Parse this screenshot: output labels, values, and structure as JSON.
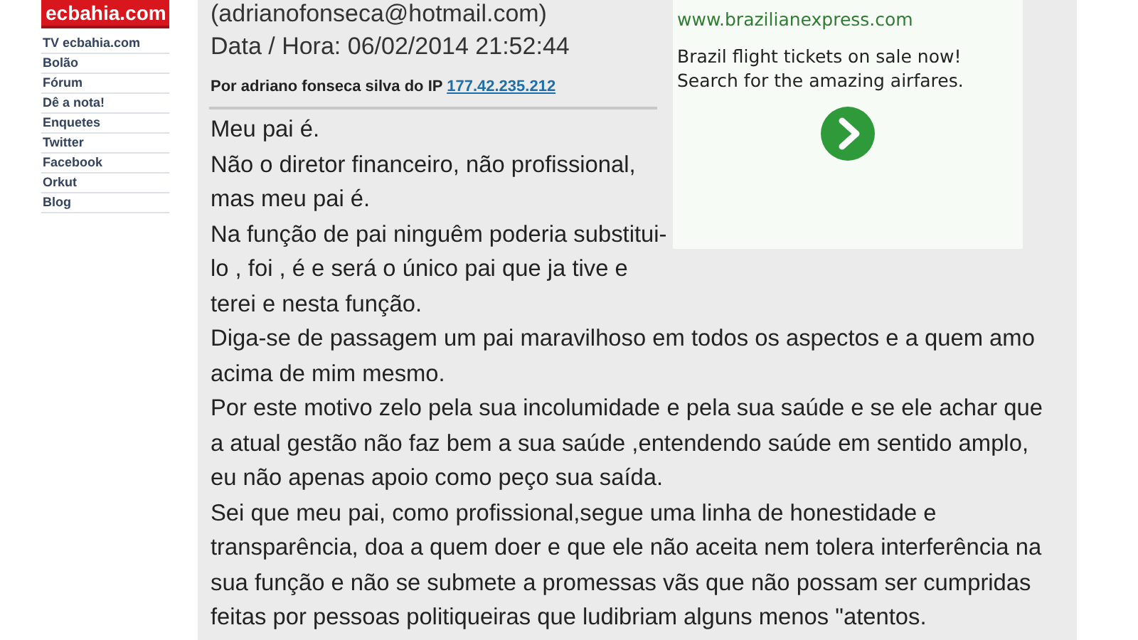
{
  "sidebar": {
    "logo": "ecbahia.com",
    "links": [
      "TV ecbahia.com",
      "Bolão",
      "Fórum",
      "Dê a nota!",
      "Enquetes",
      "Twitter",
      "Facebook",
      "Orkut",
      "Blog"
    ]
  },
  "post": {
    "email": "(adrianofonseca@hotmail.com)",
    "datetime": "Data / Hora: 06/02/2014 21:52:44",
    "author": "Por adriano fonseca silva do IP",
    "ip": "177.42.235.212",
    "paragraphs": [
      "Meu pai é.",
      "Não o diretor financeiro, não profissional, mas meu pai é.",
      "Na função de pai ninguêm poderia substitui-lo , foi , é e será o único pai que ja tive e terei e nesta função.",
      "Diga-se de passagem um pai maravilhoso em todos os aspectos e a quem amo acima de mim mesmo.",
      "Por este motivo zelo pela sua incolumidade e pela sua saúde e se ele achar que a atual gestão não faz bem a sua saúde ,entendendo saúde em sentido amplo, eu não apenas apoio como peço sua saída.",
      "Sei que meu pai, como profissional,segue uma linha de honestidade e transparência, doa a quem doer e que ele não aceita nem tolera interferência na sua função e não se submete a promessas vãs que não possam ser cumpridas feitas por pessoas politiqueiras que ludibriam alguns menos \"atentos."
    ]
  },
  "ad": {
    "url": "www.brazilianexpress.com",
    "lines": [
      "Brazil flight tickets on sale now!",
      "Search for the amazing airfares."
    ]
  }
}
